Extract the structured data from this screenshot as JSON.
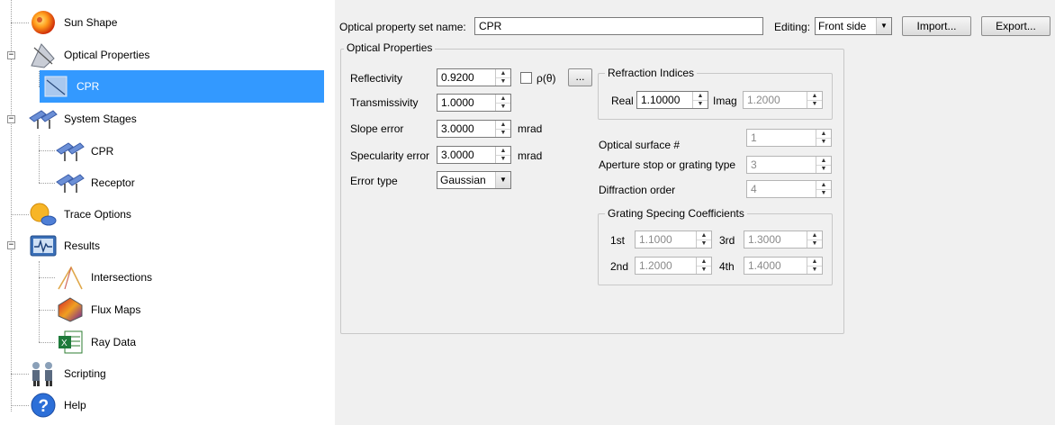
{
  "tree": {
    "items": [
      {
        "label": "Sun Shape",
        "icon": "sun-icon"
      },
      {
        "label": "Optical Properties",
        "icon": "optical-properties-icon"
      },
      {
        "label": "CPR",
        "icon": "optical-material-icon",
        "selected": true
      },
      {
        "label": "System Stages",
        "icon": "system-stages-icon"
      },
      {
        "label": "CPR",
        "icon": "stage-icon"
      },
      {
        "label": "Receptor",
        "icon": "stage-icon"
      },
      {
        "label": "Trace Options",
        "icon": "trace-options-icon"
      },
      {
        "label": "Results",
        "icon": "results-icon"
      },
      {
        "label": "Intersections",
        "icon": "intersections-icon"
      },
      {
        "label": "Flux Maps",
        "icon": "flux-maps-icon"
      },
      {
        "label": "Ray Data",
        "icon": "ray-data-icon"
      },
      {
        "label": "Scripting",
        "icon": "scripting-icon"
      },
      {
        "label": "Help",
        "icon": "help-icon"
      }
    ],
    "expanders": [
      "−",
      "−",
      "−"
    ]
  },
  "header": {
    "set_name_label": "Optical property set name:",
    "set_name_value": "CPR",
    "editing_label": "Editing:",
    "editing_value": "Front side",
    "import_label": "Import...",
    "export_label": "Export..."
  },
  "optical": {
    "group_title": "Optical Properties",
    "reflectivity_label": "Reflectivity",
    "reflectivity_value": "0.9200",
    "rho_label": "ρ(θ)",
    "rho_button": "...",
    "transmissivity_label": "Transmissivity",
    "transmissivity_value": "1.0000",
    "slope_label": "Slope error",
    "slope_value": "3.0000",
    "slope_unit": "mrad",
    "specularity_label": "Specularity error",
    "specularity_value": "3.0000",
    "specularity_unit": "mrad",
    "error_type_label": "Error type",
    "error_type_value": "Gaussian"
  },
  "refraction": {
    "group_title": "Refraction Indices",
    "real_label": "Real",
    "real_value": "1.10000",
    "imag_label": "Imag",
    "imag_value": "1.2000"
  },
  "surface": {
    "optical_surface_label": "Optical surface #",
    "optical_surface_value": "1",
    "aperture_label": "Aperture stop or grating type",
    "aperture_value": "3",
    "diffraction_label": "Diffraction order",
    "diffraction_value": "4"
  },
  "grating": {
    "group_title": "Grating Specing Coefficients",
    "c1_label": "1st",
    "c1_value": "1.1000",
    "c2_label": "2nd",
    "c2_value": "1.2000",
    "c3_label": "3rd",
    "c3_value": "1.3000",
    "c4_label": "4th",
    "c4_value": "1.4000"
  },
  "colors": {
    "selection": "#3399ff",
    "panel": "#f0f0f0"
  }
}
